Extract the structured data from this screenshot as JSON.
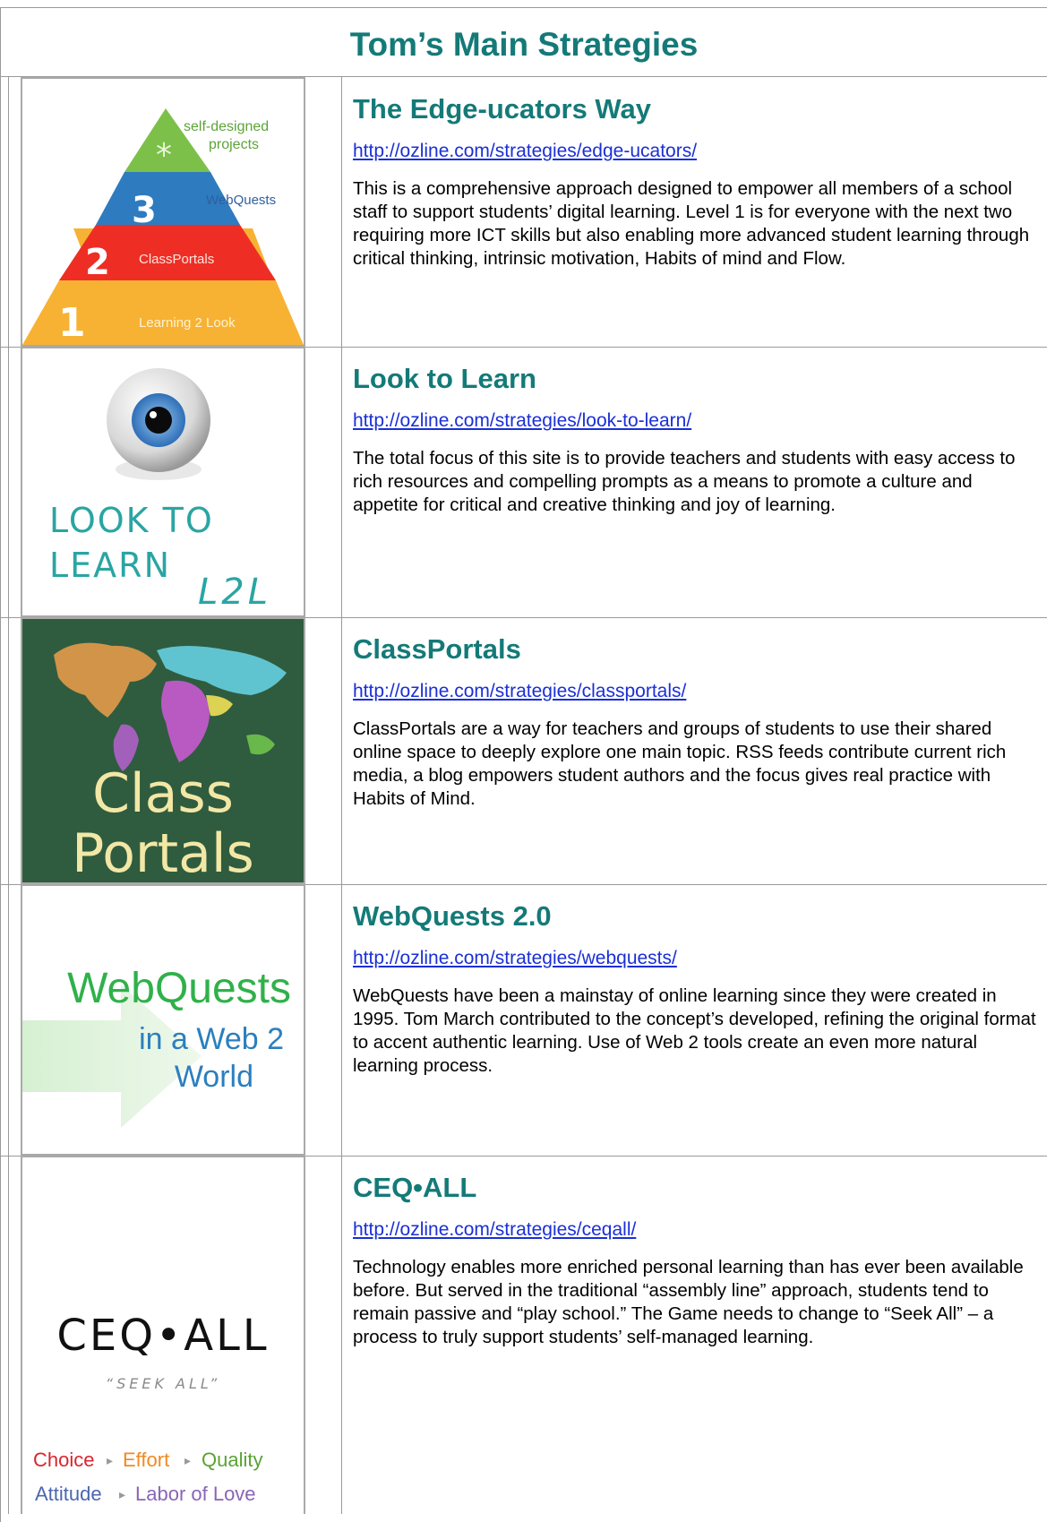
{
  "page": {
    "title": "Tom’s Main Strategies"
  },
  "strategies": [
    {
      "heading": "The Edge-ucators Way",
      "url": "http://ozline.com/strategies/edge-ucators/",
      "description": "This is a comprehensive approach designed to empower all members of a school staff to support students’ digital learning. Level 1 is for everyone with the next two requiring more ICT skills but also enabling more advanced student learning through critical thinking, intrinsic motivation, Habits of mind and Flow.",
      "image": {
        "icon": "pyramid-icon",
        "levels": [
          {
            "num": "*",
            "label": "self-designed",
            "label2": "projects",
            "color": "#7cc04a"
          },
          {
            "num": "3",
            "label": "WebQuests",
            "color": "#2e7bc0"
          },
          {
            "num": "2",
            "label": "ClassPortals",
            "color": "#ee2e24"
          },
          {
            "num": "1",
            "label": "Learning 2 Look",
            "color": "#f7b233"
          }
        ]
      }
    },
    {
      "heading": "Look to Learn",
      "url": "http://ozline.com/strategies/look-to-learn/",
      "description": "The total focus of this site is to provide teachers and students with easy access to rich resources and compelling prompts as a means to promote a culture and appetite for critical and creative thinking and joy of learning.",
      "image": {
        "icon": "eye-icon",
        "line1": "LOOK TO",
        "line2": "LEARN",
        "abbr": "L2L",
        "color": "#2aa5a3"
      }
    },
    {
      "heading": "ClassPortals",
      "url": "http://ozline.com/strategies/classportals/",
      "description": "ClassPortals are a way for teachers and groups of students to use their shared online space to deeply explore one main topic. RSS feeds contribute current rich media, a blog empowers student authors and the focus gives real practice with Habits of Mind.",
      "image": {
        "icon": "world-map-icon",
        "line1": "Class",
        "line2": "Portals",
        "bg": "#2f5c3f",
        "text_color": "#f3e7a6"
      }
    },
    {
      "heading": "WebQuests 2.0",
      "url": "http://ozline.com/strategies/webquests/",
      "description": "WebQuests have been a mainstay of online learning since they were created in 1995.  Tom March contributed to the concept’s developed, refining the original format to accent authentic learning.  Use of Web 2 tools create an even more natural learning process.",
      "image": {
        "icon": "arrow-icon",
        "line1": "WebQuests",
        "line2": "in a Web 2",
        "line3": "World",
        "color1": "#2fb14a",
        "color2": "#2b7fbd"
      }
    },
    {
      "heading": "CEQ•ALL",
      "url": "http://ozline.com/strategies/ceqall/",
      "description": "Technology enables more enriched personal learning than has ever been available before.  But served in the traditional “assembly line” approach, students tend to remain passive and “play school.”  The Game needs to change to “Seek All” – a process to truly support students’ self-managed learning.",
      "image": {
        "icon": "ceqall-logo-icon",
        "logo": "CEQ•ALL",
        "tagline": "“SEEK ALL”",
        "row1": [
          "Choice",
          "Effort",
          "Quality"
        ],
        "row2": [
          "Attitude",
          "Labor of Love"
        ],
        "colors": [
          "#d7262f",
          "#f08a24",
          "#58a433",
          "#4c66b0",
          "#8a64b8"
        ]
      }
    }
  ]
}
